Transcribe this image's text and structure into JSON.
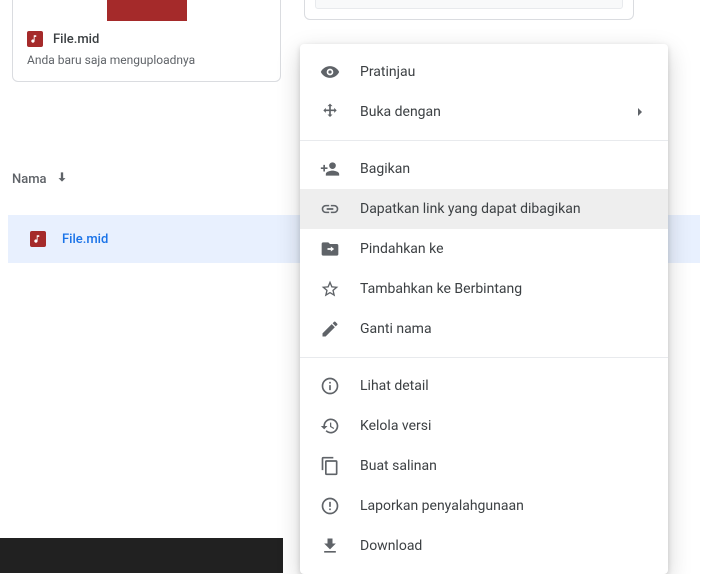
{
  "tile": {
    "filename": "File.mid",
    "subtitle": "Anda baru saja menguploadnya"
  },
  "list": {
    "header_name": "Nama",
    "selected_filename": "File.mid"
  },
  "menu": {
    "preview": "Pratinjau",
    "open_with": "Buka dengan",
    "share": "Bagikan",
    "get_link": "Dapatkan link yang dapat dibagikan",
    "move_to": "Pindahkan ke",
    "add_star": "Tambahkan ke Berbintang",
    "rename": "Ganti nama",
    "details": "Lihat detail",
    "versions": "Kelola versi",
    "copy": "Buat salinan",
    "report": "Laporkan penyalahgunaan",
    "download": "Download"
  }
}
